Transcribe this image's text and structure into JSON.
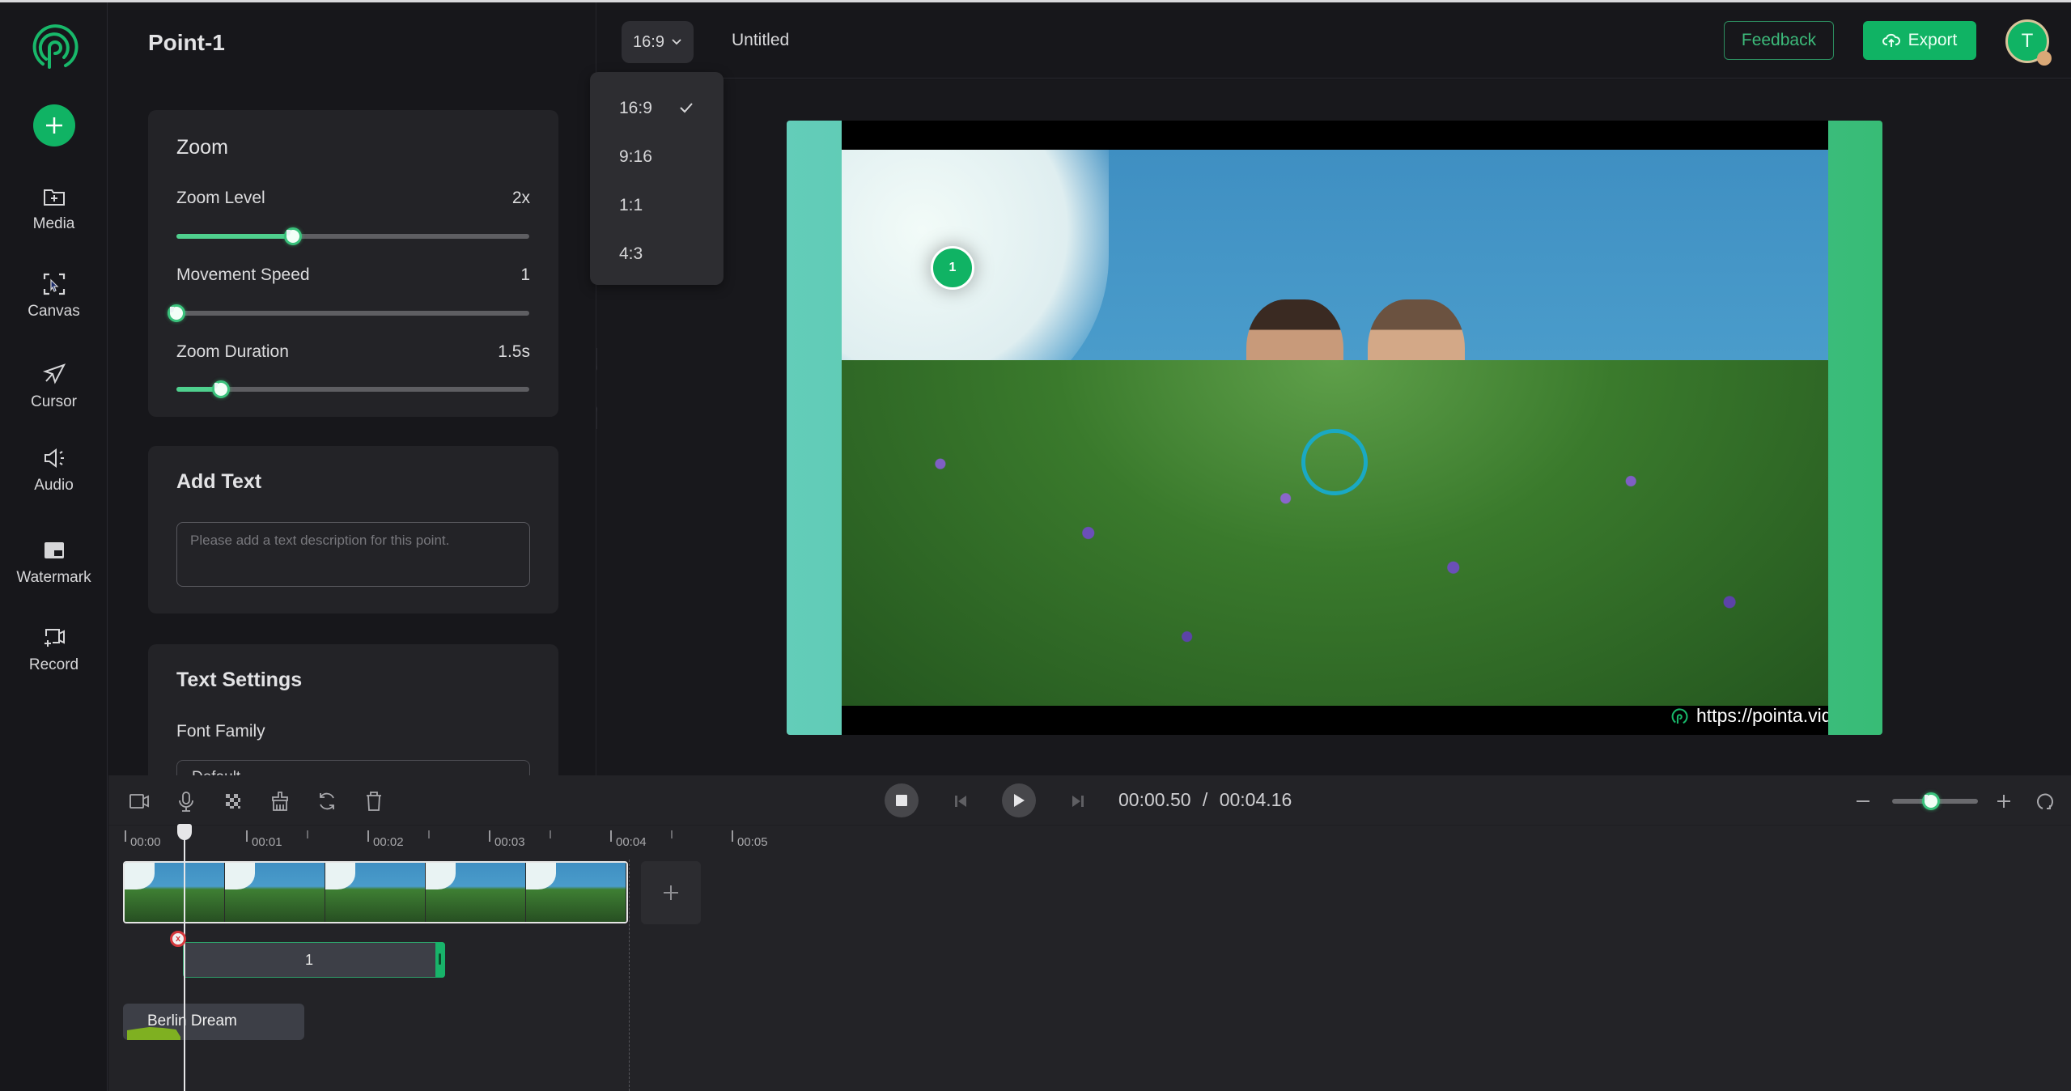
{
  "app": {
    "logo_icon": "pointa-logo-icon",
    "accent_color": "#10b364"
  },
  "sidebar": {
    "add_icon": "plus-icon",
    "items": [
      {
        "label": "Media",
        "icon": "folder-plus-icon"
      },
      {
        "label": "Canvas",
        "icon": "canvas-select-icon"
      },
      {
        "label": "Cursor",
        "icon": "cursor-arrow-icon"
      },
      {
        "label": "Audio",
        "icon": "speaker-icon"
      },
      {
        "label": "Watermark",
        "icon": "watermark-icon"
      },
      {
        "label": "Record",
        "icon": "record-screen-icon"
      }
    ]
  },
  "panel": {
    "title": "Point-1",
    "zoom": {
      "title": "Zoom",
      "zoom_level": {
        "label": "Zoom Level",
        "value": "2x",
        "fraction": 0.33
      },
      "movement_speed": {
        "label": "Movement Speed",
        "value": "1",
        "fraction": 0.0
      },
      "zoom_duration": {
        "label": "Zoom Duration",
        "value": "1.5s",
        "fraction": 0.125
      }
    },
    "add_text": {
      "title": "Add Text",
      "placeholder": "Please add a text description for this point.",
      "value": ""
    },
    "text_settings": {
      "title": "Text Settings",
      "font_family_label": "Font Family",
      "font_family_value": "Default"
    }
  },
  "topbar": {
    "aspect_ratio": "16:9",
    "document_title": "Untitled",
    "feedback_label": "Feedback",
    "export_label": "Export",
    "avatar_initial": "T"
  },
  "aspect_dropdown": {
    "options": [
      "16:9",
      "9:16",
      "1:1",
      "4:3"
    ],
    "selected": "16:9"
  },
  "preview": {
    "marker_label": "1",
    "watermark_text": "https://pointa.video"
  },
  "timeline": {
    "current_time": "00:00.50",
    "separator": "/",
    "total_time": "00:04.16",
    "ruler_labels": [
      "00:00",
      "00:01",
      "00:02",
      "00:03",
      "00:04",
      "00:05"
    ],
    "point_clip_label": "1",
    "audio_clip_name": "Berlin Dream",
    "zoom_slider_fraction": 0.45,
    "tools": [
      "camera-icon",
      "microphone-icon",
      "blur-icon",
      "brush-clean-icon",
      "refresh-icon",
      "trash-icon"
    ]
  }
}
